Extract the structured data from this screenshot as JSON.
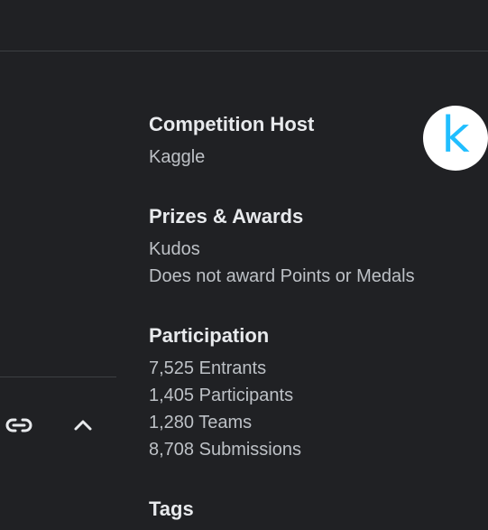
{
  "host": {
    "heading": "Competition Host",
    "name": "Kaggle",
    "logo_letter": "k",
    "logo_color": "#20beff"
  },
  "prizes": {
    "heading": "Prizes & Awards",
    "lines": [
      "Kudos",
      "Does not award Points or Medals"
    ]
  },
  "participation": {
    "heading": "Participation",
    "lines": [
      "7,525 Entrants",
      "1,405 Participants",
      "1,280 Teams",
      "8,708 Submissions"
    ]
  },
  "tags": {
    "heading": "Tags"
  },
  "toolbar": {
    "icons": [
      "link-icon",
      "chevron-up-icon"
    ]
  }
}
